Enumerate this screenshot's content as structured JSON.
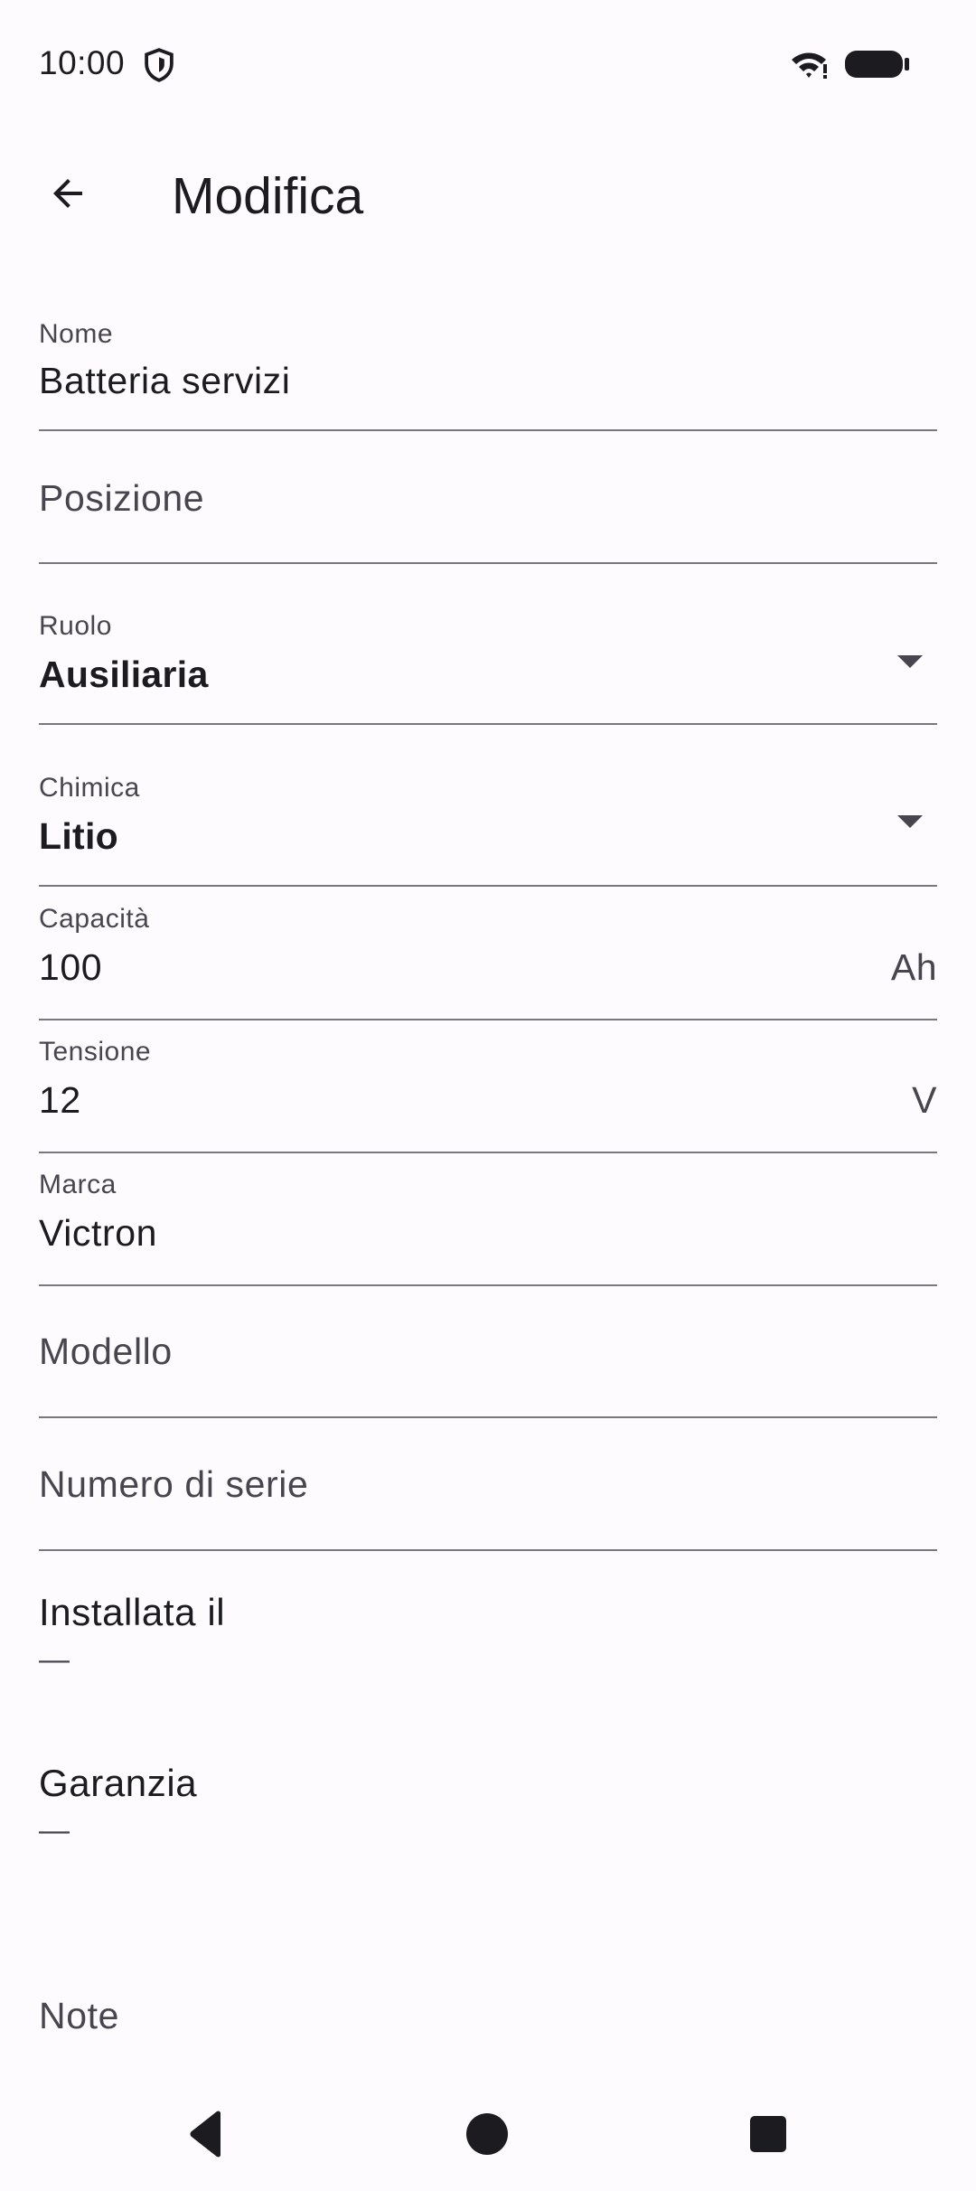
{
  "status_bar": {
    "time": "10:00",
    "icons": [
      "shield-icon",
      "wifi-icon",
      "battery-icon"
    ]
  },
  "top_bar": {
    "title": "Modifica",
    "back_icon": "arrow-left-icon"
  },
  "form": {
    "nome": {
      "label": "Nome",
      "value": "Batteria servizi"
    },
    "posizione": {
      "placeholder": "Posizione"
    },
    "ruolo": {
      "label": "Ruolo",
      "value": "Ausiliaria"
    },
    "chimica": {
      "label": "Chimica",
      "value": "Litio"
    },
    "capacita": {
      "label": "Capacità",
      "value": "100",
      "suffix": "Ah"
    },
    "tensione": {
      "label": "Tensione",
      "value": "12",
      "suffix": "V"
    },
    "marca": {
      "label": "Marca",
      "value": "Victron"
    },
    "modello": {
      "placeholder": "Modello"
    },
    "numero_serie": {
      "placeholder": "Numero di serie"
    },
    "installata": {
      "label": "Installata il",
      "value": "—"
    },
    "garanzia": {
      "label": "Garanzia",
      "value": "—"
    },
    "note": {
      "placeholder": "Note"
    }
  },
  "nav_bar": {
    "icons": [
      "back-triangle-icon",
      "home-circle-icon",
      "recents-square-icon"
    ]
  },
  "colors": {
    "background": "#FDFBFE",
    "text_primary": "#1C1B1F",
    "text_secondary": "#49454F",
    "divider": "#79767D"
  }
}
